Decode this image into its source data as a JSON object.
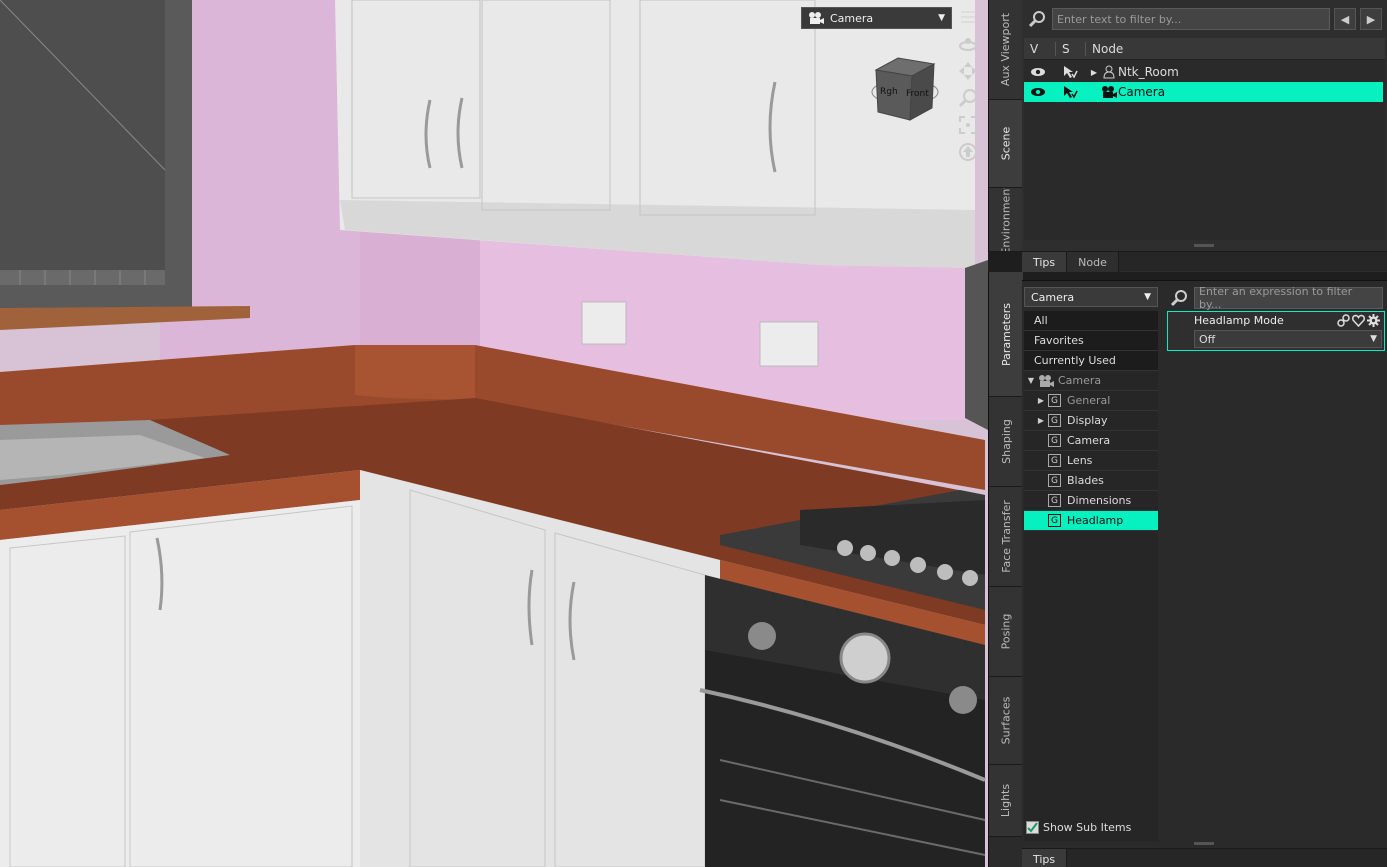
{
  "viewport": {
    "camera_select": {
      "value": "Camera",
      "icon": "camera-icon"
    },
    "tools": [
      "list-icon",
      "orbit-icon",
      "pan-icon",
      "zoom-icon",
      "frame-icon",
      "reset-icon"
    ],
    "cube_faces": {
      "left": "Rgh",
      "front": "Front"
    }
  },
  "side_tabs_top": [
    "Aux Viewport",
    "Scene",
    "Environment"
  ],
  "side_tabs_bottom": [
    "Parameters",
    "Shaping",
    "Face Transfer",
    "Posing",
    "Surfaces",
    "Lights"
  ],
  "scene": {
    "filter_placeholder": "Enter text to filter by...",
    "columns": {
      "v": "V",
      "s": "S",
      "node": "Node"
    },
    "rows": [
      {
        "label": "Ntk_Room",
        "icon": "figure-icon",
        "selected": false
      },
      {
        "label": "Camera",
        "icon": "camera-icon",
        "selected": true
      }
    ],
    "tabs": [
      "Tips",
      "Node"
    ]
  },
  "parameters": {
    "node_select": "Camera",
    "filter_placeholder": "Enter an expression to filter by...",
    "top_items": [
      "All",
      "Favorites",
      "Currently Used"
    ],
    "root": "Camera",
    "groups": [
      {
        "label": "General",
        "expandable": true,
        "selected": false
      },
      {
        "label": "Display",
        "expandable": true,
        "selected": false
      },
      {
        "label": "Camera",
        "expandable": false,
        "selected": false
      },
      {
        "label": "Lens",
        "expandable": false,
        "selected": false
      },
      {
        "label": "Blades",
        "expandable": false,
        "selected": false
      },
      {
        "label": "Dimensions",
        "expandable": false,
        "selected": false
      },
      {
        "label": "Headlamp",
        "expandable": false,
        "selected": true
      }
    ],
    "group_icon_letter": "G",
    "property": {
      "title": "Headlamp Mode",
      "value": "Off"
    },
    "show_sub_items": "Show Sub Items",
    "tabs": [
      "Tips"
    ]
  },
  "colors": {
    "selection": "#06f0c0",
    "wall": "#e6bee0",
    "worktop": "#8a3b22"
  }
}
